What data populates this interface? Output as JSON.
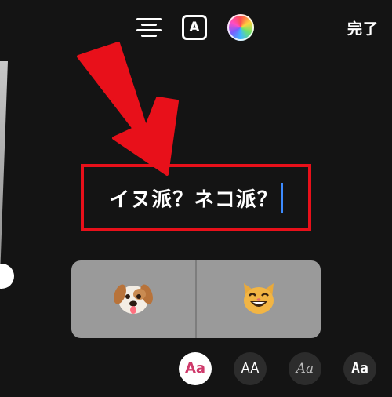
{
  "toolbar": {
    "alignment_icon": "align-center-icon",
    "text_style_label": "A",
    "color_icon": "color-wheel-icon",
    "done_label": "完了"
  },
  "editor": {
    "text": "イヌ派？ネコ派？"
  },
  "poll": {
    "options": [
      {
        "emoji": "🐶",
        "icon": "dog-face-icon"
      },
      {
        "emoji": "😸",
        "icon": "cat-face-icon"
      }
    ]
  },
  "fonts": [
    {
      "label": "Aa",
      "selected": true
    },
    {
      "label": "AA",
      "selected": false
    },
    {
      "label": "Aa",
      "selected": false
    },
    {
      "label": "Aa",
      "selected": false
    }
  ],
  "annotation": {
    "arrow_color": "#e8101a",
    "box_color": "#e8101a"
  }
}
